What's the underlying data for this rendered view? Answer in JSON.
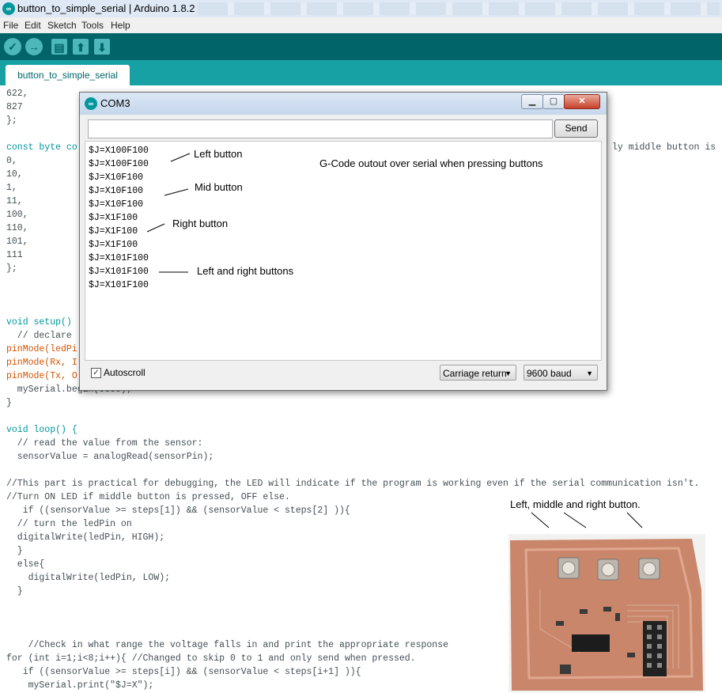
{
  "window": {
    "title": "button_to_simple_serial | Arduino 1.8.2",
    "app_icon": "arduino-logo-icon"
  },
  "menu": {
    "items": [
      "File",
      "Edit",
      "Sketch",
      "Tools",
      "Help"
    ]
  },
  "toolbar": {
    "buttons": [
      "verify-icon",
      "upload-icon",
      "new-icon",
      "open-icon",
      "save-icon"
    ]
  },
  "tab": {
    "label": "button_to_simple_serial"
  },
  "code": {
    "top_lines": [
      "622,",
      "827",
      "};"
    ],
    "const_prefix": "const byte co",
    "const_suffix": "ly middle button is p",
    "array_values": [
      "0,",
      "10,",
      "1,",
      "11,",
      "100,",
      "110,",
      "101,",
      "111",
      "};"
    ],
    "setup_line": "void setup()",
    "declare_line": "  // declare",
    "pinmode1": "pinMode(ledPi",
    "pinmode2": "pinMode(Rx, I",
    "pinmode3": "pinMode(Tx, O",
    "myserial_begin": "  mySerial.begin(9600);",
    "close_brace": "}",
    "loop_line": "void loop() {",
    "read_comment": "  // read the value from the sensor:",
    "sensor_line": "  sensorValue = analogRead(sensorPin);",
    "comment1": "//This part is practical for debugging, the LED will indicate if the program is working even if the serial communication isn't.",
    "comment2": "//Turn ON LED if middle button is pressed, OFF else.",
    "if1": "   if ((sensorValue >= steps[1]) && (sensorValue < steps[2] )){",
    "turn_comment": "  // turn the ledPin on",
    "dw_high": "  digitalWrite(ledPin, HIGH);",
    "brace1": "  }",
    "else_line": "  else{",
    "dw_low": "    digitalWrite(ledPin, LOW);",
    "brace2": "  }",
    "check_comment": "    //Check in what range the voltage falls in and print the appropriate response",
    "for_line": "for (int i=1;i<8;i++){ //Changed to skip 0 to 1 and only send when pressed.",
    "if2": "   if ((sensorValue >= steps[i]) && (sensorValue < steps[i+1] )){",
    "print_line": "    mySerial.print(\"$J=X\");"
  },
  "serial_monitor": {
    "title": "COM3",
    "input_value": "",
    "send_label": "Send",
    "output_lines": [
      "$J=X100F100",
      "$J=X100F100",
      "$J=X10F100",
      "$J=X10F100",
      "$J=X10F100",
      "$J=X1F100",
      "$J=X1F100",
      "$J=X1F100",
      "$J=X101F100",
      "$J=X101F100",
      "$J=X101F100"
    ],
    "annotations": {
      "left": "Left button",
      "mid": "Mid button",
      "right": "Right button",
      "left_right": "Left and right buttons",
      "heading": "G-Code outout over serial when pressing buttons"
    },
    "autoscroll_label": "Autoscroll",
    "autoscroll_checked": true,
    "line_ending": "Carriage return",
    "baud": "9600 baud"
  },
  "photo": {
    "caption": "Left, middle and right button."
  }
}
